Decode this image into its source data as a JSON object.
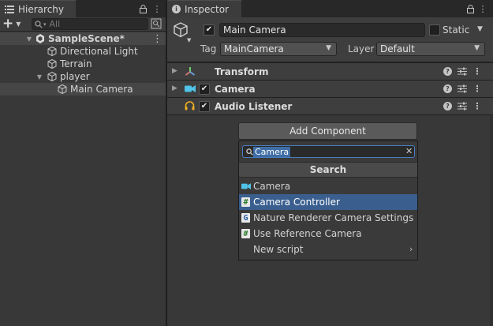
{
  "hierarchy": {
    "tab_label": "Hierarchy",
    "add_label": "+",
    "search_placeholder": "All",
    "items": [
      {
        "label": "SampleScene*"
      },
      {
        "label": "Directional Light"
      },
      {
        "label": "Terrain"
      },
      {
        "label": "player"
      },
      {
        "label": "Main Camera"
      }
    ]
  },
  "inspector": {
    "tab_label": "Inspector",
    "object_name": "Main Camera",
    "static_label": "Static",
    "tag_label": "Tag",
    "tag_value": "MainCamera",
    "layer_label": "Layer",
    "layer_value": "Default",
    "components": [
      {
        "label": "Transform"
      },
      {
        "label": "Camera"
      },
      {
        "label": "Audio Listener"
      }
    ]
  },
  "add_component": {
    "button_label": "Add Component",
    "search_value": "Camera",
    "section_title": "Search",
    "results": [
      {
        "label": "Camera"
      },
      {
        "label": "Camera Controller"
      },
      {
        "label": "Nature Renderer Camera Settings"
      },
      {
        "label": "Use Reference Camera"
      },
      {
        "label": "New script"
      }
    ]
  },
  "colors": {
    "selection": "#3a5f8f",
    "panel": "#383838",
    "component_header": "#3e3e3e"
  }
}
